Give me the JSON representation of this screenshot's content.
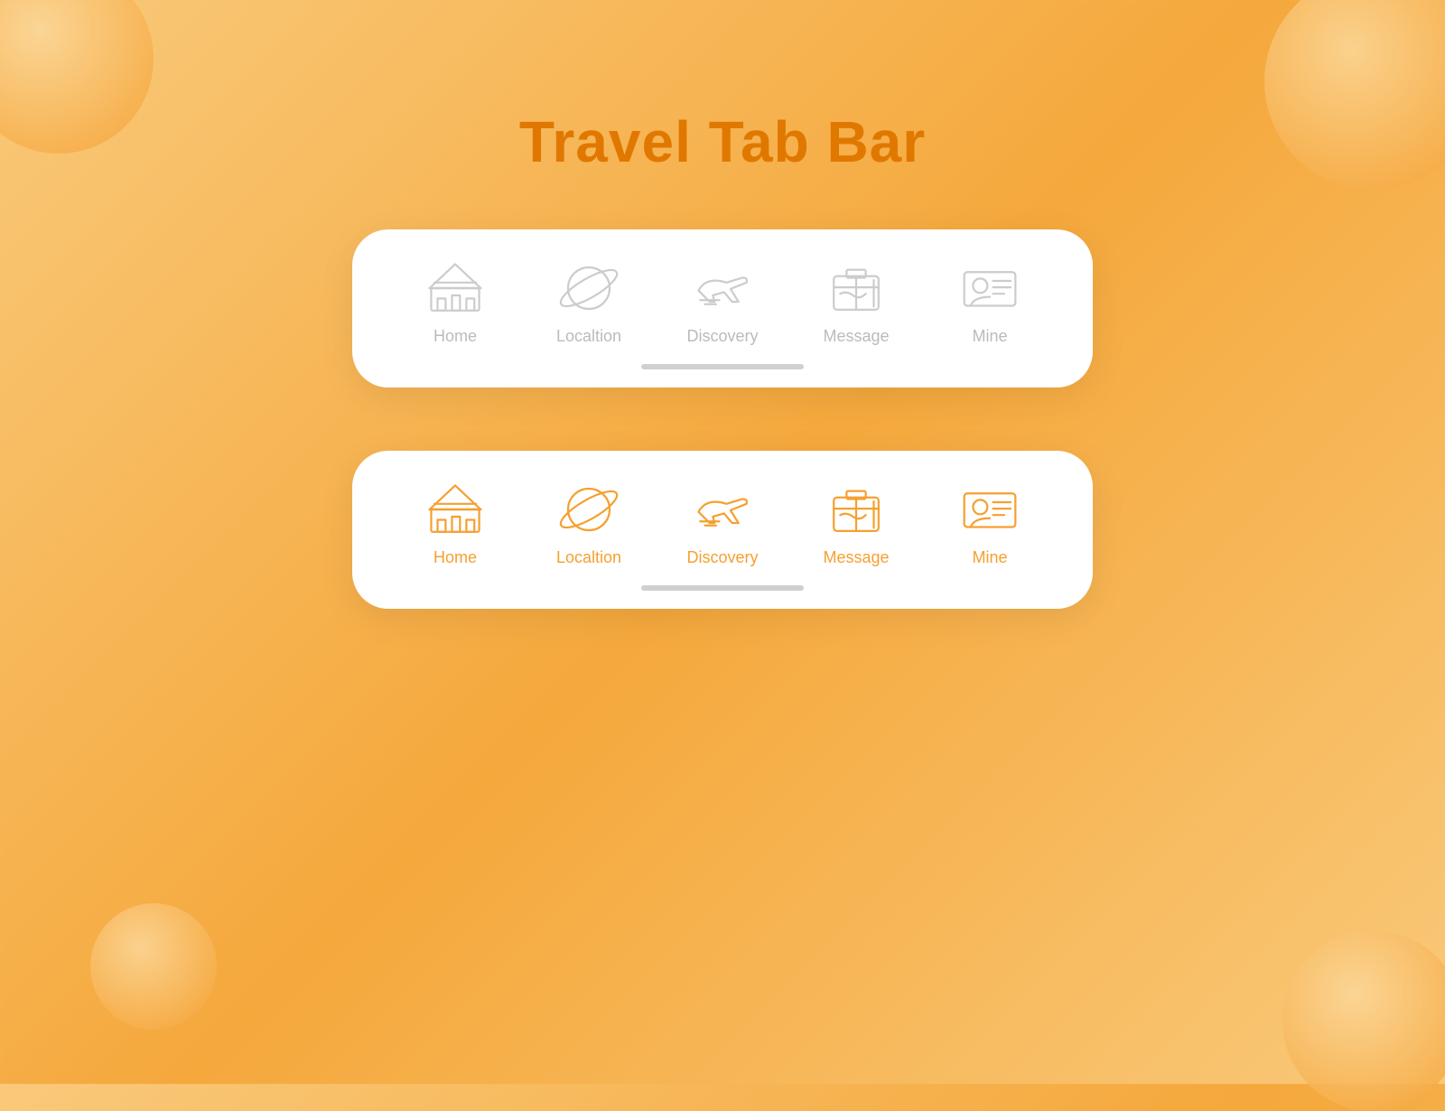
{
  "page": {
    "title": "Travel Tab Bar",
    "background_colors": [
      "#f9c97a",
      "#f5a83c"
    ],
    "accent_color": "#f5a030",
    "gray_color": "#cccccc"
  },
  "tab_bars": [
    {
      "id": "inactive-bar",
      "state": "inactive",
      "items": [
        {
          "id": "home",
          "label": "Home",
          "icon": "temple-icon"
        },
        {
          "id": "location",
          "label": "Localtion",
          "icon": "planet-icon"
        },
        {
          "id": "discovery",
          "label": "Discovery",
          "icon": "plane-icon"
        },
        {
          "id": "message",
          "label": "Message",
          "icon": "luggage-icon"
        },
        {
          "id": "mine",
          "label": "Mine",
          "icon": "id-card-icon"
        }
      ]
    },
    {
      "id": "active-bar",
      "state": "active",
      "items": [
        {
          "id": "home",
          "label": "Home",
          "icon": "temple-icon"
        },
        {
          "id": "location",
          "label": "Localtion",
          "icon": "planet-icon"
        },
        {
          "id": "discovery",
          "label": "Discovery",
          "icon": "plane-icon"
        },
        {
          "id": "message",
          "label": "Message",
          "icon": "luggage-icon"
        },
        {
          "id": "mine",
          "label": "Mine",
          "icon": "id-card-icon"
        }
      ]
    }
  ]
}
